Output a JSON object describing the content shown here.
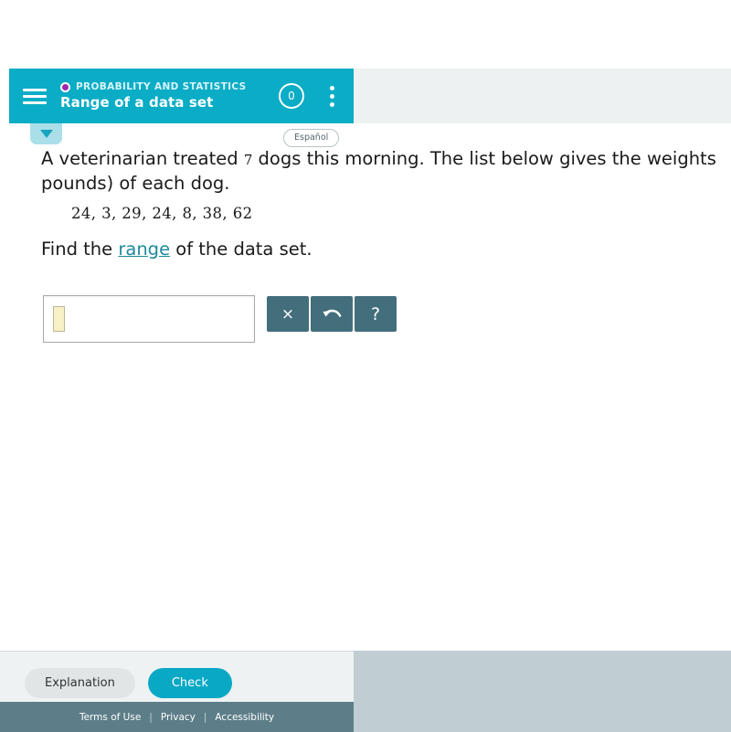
{
  "header": {
    "menu_icon": "hamburger-icon",
    "category": "PROBABILITY AND STATISTICS",
    "title": "Range of a data set",
    "score": "0",
    "overflow_icon": "kebab-menu-icon",
    "accent_color": "#0aacc6",
    "category_dot_color": "#9c27b0"
  },
  "toolbar": {
    "collapse_icon": "chevron-down-icon",
    "language_label": "Español"
  },
  "question": {
    "stem_before_count": "A veterinarian treated ",
    "count": "7",
    "stem_after_count": " dogs this morning. The list below gives the weights pounds) of each dog.",
    "data_values": "24, 3, 29, 24, 8, 38, 62",
    "prompt_prefix": "Find the ",
    "prompt_link": "range",
    "prompt_suffix": " of the data set.",
    "link_color": "#1d8a9c"
  },
  "answer": {
    "value": "",
    "placeholder": "",
    "tools": [
      {
        "name": "clear-button",
        "glyph": "×"
      },
      {
        "name": "undo-button",
        "glyph": "undo-arrow-icon"
      },
      {
        "name": "help-button",
        "glyph": "?"
      }
    ],
    "tool_color": "#436e7c"
  },
  "actions": {
    "explanation_label": "Explanation",
    "check_label": "Check",
    "check_color": "#09a8c4"
  },
  "footer": {
    "terms_label": "Terms of Use",
    "privacy_label": "Privacy",
    "accessibility_label": "Accessibility",
    "separator": "|"
  }
}
